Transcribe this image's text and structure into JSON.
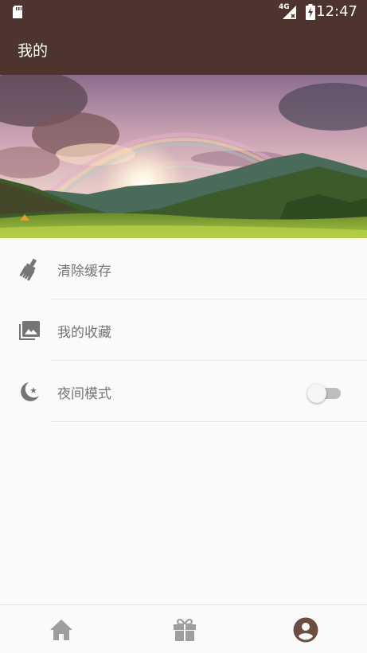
{
  "status_bar": {
    "network": "4G",
    "time": "12:47",
    "icons": [
      "sd-card-icon",
      "signal-icon",
      "battery-charging-icon"
    ]
  },
  "app_bar": {
    "title": "我的"
  },
  "banner": {
    "image": "rainbow-mountain-landscape"
  },
  "menu": {
    "items": [
      {
        "label": "清除缓存",
        "icon": "broom-icon"
      },
      {
        "label": "我的收藏",
        "icon": "photo-library-icon"
      },
      {
        "label": "夜间模式",
        "icon": "moon-star-icon",
        "toggle": false
      }
    ]
  },
  "bottom_nav": {
    "items": [
      {
        "icon": "home-icon",
        "active": false
      },
      {
        "icon": "gift-icon",
        "active": false
      },
      {
        "icon": "account-icon",
        "active": true
      }
    ],
    "active_color": "#6d4c41",
    "inactive_color": "#9e9e9e"
  },
  "colors": {
    "primary": "#4e342e",
    "text_secondary": "#757575"
  }
}
